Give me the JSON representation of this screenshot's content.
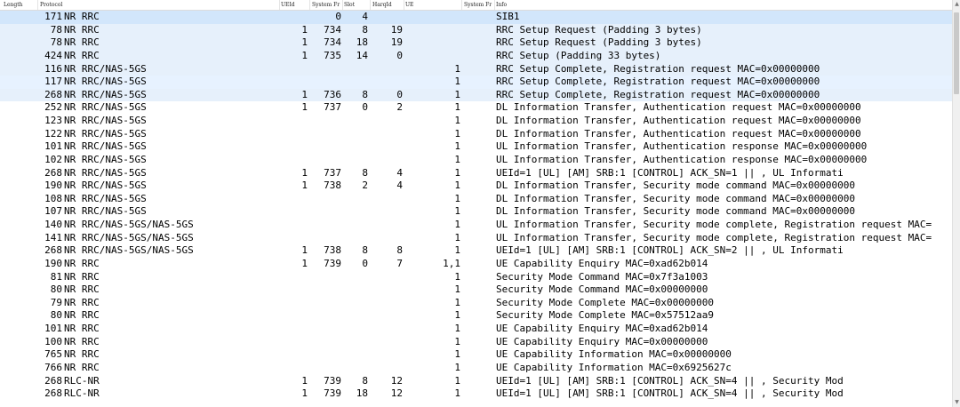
{
  "columns": {
    "length": "Length",
    "protocol": "Protocol",
    "ueid": "UEId",
    "system_frame": "System Fr",
    "slot": "Slot",
    "harq_id": "HarqId",
    "ue": "UE",
    "system_fn": "System Fr",
    "info": "Info"
  },
  "rows": [
    {
      "length": "171",
      "protocol": "NR RRC",
      "ueid": "",
      "frame": "0",
      "slot": "4",
      "harq": "",
      "sfn": "",
      "info": "SIB1",
      "state": "selected"
    },
    {
      "length": "78",
      "protocol": "NR RRC",
      "ueid": "1",
      "frame": "734",
      "slot": "8",
      "harq": "19",
      "sfn": "",
      "info": "RRC Setup Request  (Padding 3 bytes)",
      "state": "alt"
    },
    {
      "length": "78",
      "protocol": "NR RRC",
      "ueid": "1",
      "frame": "734",
      "slot": "18",
      "harq": "19",
      "sfn": "",
      "info": "RRC Setup Request  (Padding 3 bytes)",
      "state": "alt"
    },
    {
      "length": "424",
      "protocol": "NR RRC",
      "ueid": "1",
      "frame": "735",
      "slot": "14",
      "harq": "0",
      "sfn": "",
      "info": "RRC Setup  (Padding 33 bytes)",
      "state": "alt"
    },
    {
      "length": "116",
      "protocol": "NR RRC/NAS-5GS",
      "ueid": "",
      "frame": "",
      "slot": "",
      "harq": "",
      "sfn": "1",
      "info": "RRC Setup Complete, Registration request MAC=0x00000000",
      "state": "alt"
    },
    {
      "length": "117",
      "protocol": "NR RRC/NAS-5GS",
      "ueid": "",
      "frame": "",
      "slot": "",
      "harq": "",
      "sfn": "1",
      "info": "RRC Setup Complete, Registration request MAC=0x00000000",
      "state": "hl"
    },
    {
      "length": "268",
      "protocol": "NR RRC/NAS-5GS",
      "ueid": "1",
      "frame": "736",
      "slot": "8",
      "harq": "0",
      "sfn": "1",
      "info": "RRC Setup Complete, Registration request MAC=0x00000000",
      "state": "alt"
    },
    {
      "length": "252",
      "protocol": "NR RRC/NAS-5GS",
      "ueid": "1",
      "frame": "737",
      "slot": "0",
      "harq": "2",
      "sfn": "1",
      "info": "DL Information Transfer, Authentication request MAC=0x00000000",
      "state": "plain"
    },
    {
      "length": "123",
      "protocol": "NR RRC/NAS-5GS",
      "ueid": "",
      "frame": "",
      "slot": "",
      "harq": "",
      "sfn": "1",
      "info": "DL Information Transfer, Authentication request MAC=0x00000000",
      "state": "plain"
    },
    {
      "length": "122",
      "protocol": "NR RRC/NAS-5GS",
      "ueid": "",
      "frame": "",
      "slot": "",
      "harq": "",
      "sfn": "1",
      "info": "DL Information Transfer, Authentication request MAC=0x00000000",
      "state": "plain"
    },
    {
      "length": "101",
      "protocol": "NR RRC/NAS-5GS",
      "ueid": "",
      "frame": "",
      "slot": "",
      "harq": "",
      "sfn": "1",
      "info": "UL Information Transfer, Authentication response MAC=0x00000000",
      "state": "plain"
    },
    {
      "length": "102",
      "protocol": "NR RRC/NAS-5GS",
      "ueid": "",
      "frame": "",
      "slot": "",
      "harq": "",
      "sfn": "1",
      "info": "UL Information Transfer, Authentication response MAC=0x00000000",
      "state": "plain"
    },
    {
      "length": "268",
      "protocol": "NR RRC/NAS-5GS",
      "ueid": "1",
      "frame": "737",
      "slot": "8",
      "harq": "4",
      "sfn": "1",
      "info": "UEId=1      [UL] [AM] SRB:1  [CONTROL]  ACK_SN=1          ||    , UL Informati",
      "state": "plain"
    },
    {
      "length": "190",
      "protocol": "NR RRC/NAS-5GS",
      "ueid": "1",
      "frame": "738",
      "slot": "2",
      "harq": "4",
      "sfn": "1",
      "info": "DL Information Transfer, Security mode command MAC=0x00000000",
      "state": "plain"
    },
    {
      "length": "108",
      "protocol": "NR RRC/NAS-5GS",
      "ueid": "",
      "frame": "",
      "slot": "",
      "harq": "",
      "sfn": "1",
      "info": "DL Information Transfer, Security mode command MAC=0x00000000",
      "state": "plain"
    },
    {
      "length": "107",
      "protocol": "NR RRC/NAS-5GS",
      "ueid": "",
      "frame": "",
      "slot": "",
      "harq": "",
      "sfn": "1",
      "info": "DL Information Transfer, Security mode command MAC=0x00000000",
      "state": "plain"
    },
    {
      "length": "140",
      "protocol": "NR RRC/NAS-5GS/NAS-5GS",
      "ueid": "",
      "frame": "",
      "slot": "",
      "harq": "",
      "sfn": "1",
      "info": "UL Information Transfer, Security mode complete, Registration request MAC=",
      "state": "plain"
    },
    {
      "length": "141",
      "protocol": "NR RRC/NAS-5GS/NAS-5GS",
      "ueid": "",
      "frame": "",
      "slot": "",
      "harq": "",
      "sfn": "1",
      "info": "UL Information Transfer, Security mode complete, Registration request MAC=",
      "state": "plain"
    },
    {
      "length": "268",
      "protocol": "NR RRC/NAS-5GS/NAS-5GS",
      "ueid": "1",
      "frame": "738",
      "slot": "8",
      "harq": "8",
      "sfn": "1",
      "info": "UEId=1      [UL] [AM] SRB:1  [CONTROL]  ACK_SN=2          ||    , UL Informati",
      "state": "plain"
    },
    {
      "length": "190",
      "protocol": "NR RRC",
      "ueid": "1",
      "frame": "739",
      "slot": "0",
      "harq": "7",
      "sfn": "1,1",
      "info": "UE Capability Enquiry MAC=0xad62b014",
      "state": "plain"
    },
    {
      "length": "81",
      "protocol": "NR RRC",
      "ueid": "",
      "frame": "",
      "slot": "",
      "harq": "",
      "sfn": "1",
      "info": "Security Mode Command MAC=0x7f3a1003",
      "state": "plain"
    },
    {
      "length": "80",
      "protocol": "NR RRC",
      "ueid": "",
      "frame": "",
      "slot": "",
      "harq": "",
      "sfn": "1",
      "info": "Security Mode Command MAC=0x00000000",
      "state": "plain"
    },
    {
      "length": "79",
      "protocol": "NR RRC",
      "ueid": "",
      "frame": "",
      "slot": "",
      "harq": "",
      "sfn": "1",
      "info": "Security Mode Complete MAC=0x00000000",
      "state": "plain"
    },
    {
      "length": "80",
      "protocol": "NR RRC",
      "ueid": "",
      "frame": "",
      "slot": "",
      "harq": "",
      "sfn": "1",
      "info": "Security Mode Complete MAC=0x57512aa9",
      "state": "plain"
    },
    {
      "length": "101",
      "protocol": "NR RRC",
      "ueid": "",
      "frame": "",
      "slot": "",
      "harq": "",
      "sfn": "1",
      "info": "UE Capability Enquiry MAC=0xad62b014",
      "state": "plain"
    },
    {
      "length": "100",
      "protocol": "NR RRC",
      "ueid": "",
      "frame": "",
      "slot": "",
      "harq": "",
      "sfn": "1",
      "info": "UE Capability Enquiry MAC=0x00000000",
      "state": "plain"
    },
    {
      "length": "765",
      "protocol": "NR RRC",
      "ueid": "",
      "frame": "",
      "slot": "",
      "harq": "",
      "sfn": "1",
      "info": "UE Capability Information MAC=0x00000000",
      "state": "plain"
    },
    {
      "length": "766",
      "protocol": "NR RRC",
      "ueid": "",
      "frame": "",
      "slot": "",
      "harq": "",
      "sfn": "1",
      "info": "UE Capability Information MAC=0x6925627c",
      "state": "plain"
    },
    {
      "length": "268",
      "protocol": "RLC-NR",
      "ueid": "1",
      "frame": "739",
      "slot": "8",
      "harq": "12",
      "sfn": "1",
      "info": "UEId=1      [UL] [AM] SRB:1  [CONTROL]  ACK_SN=4          ||    , Security Mod",
      "state": "plain"
    },
    {
      "length": "268",
      "protocol": "RLC-NR",
      "ueid": "1",
      "frame": "739",
      "slot": "18",
      "harq": "12",
      "sfn": "1",
      "info": "UEId=1      [UL] [AM] SRB:1  [CONTROL]  ACK_SN=4          ||    , Security Mod",
      "state": "plain"
    }
  ],
  "colors": {
    "selected_row": "#d2e6fb",
    "alt_row": "#e6f0fb",
    "highlight_row": "#e7f2ff",
    "background": "#ffffff"
  }
}
